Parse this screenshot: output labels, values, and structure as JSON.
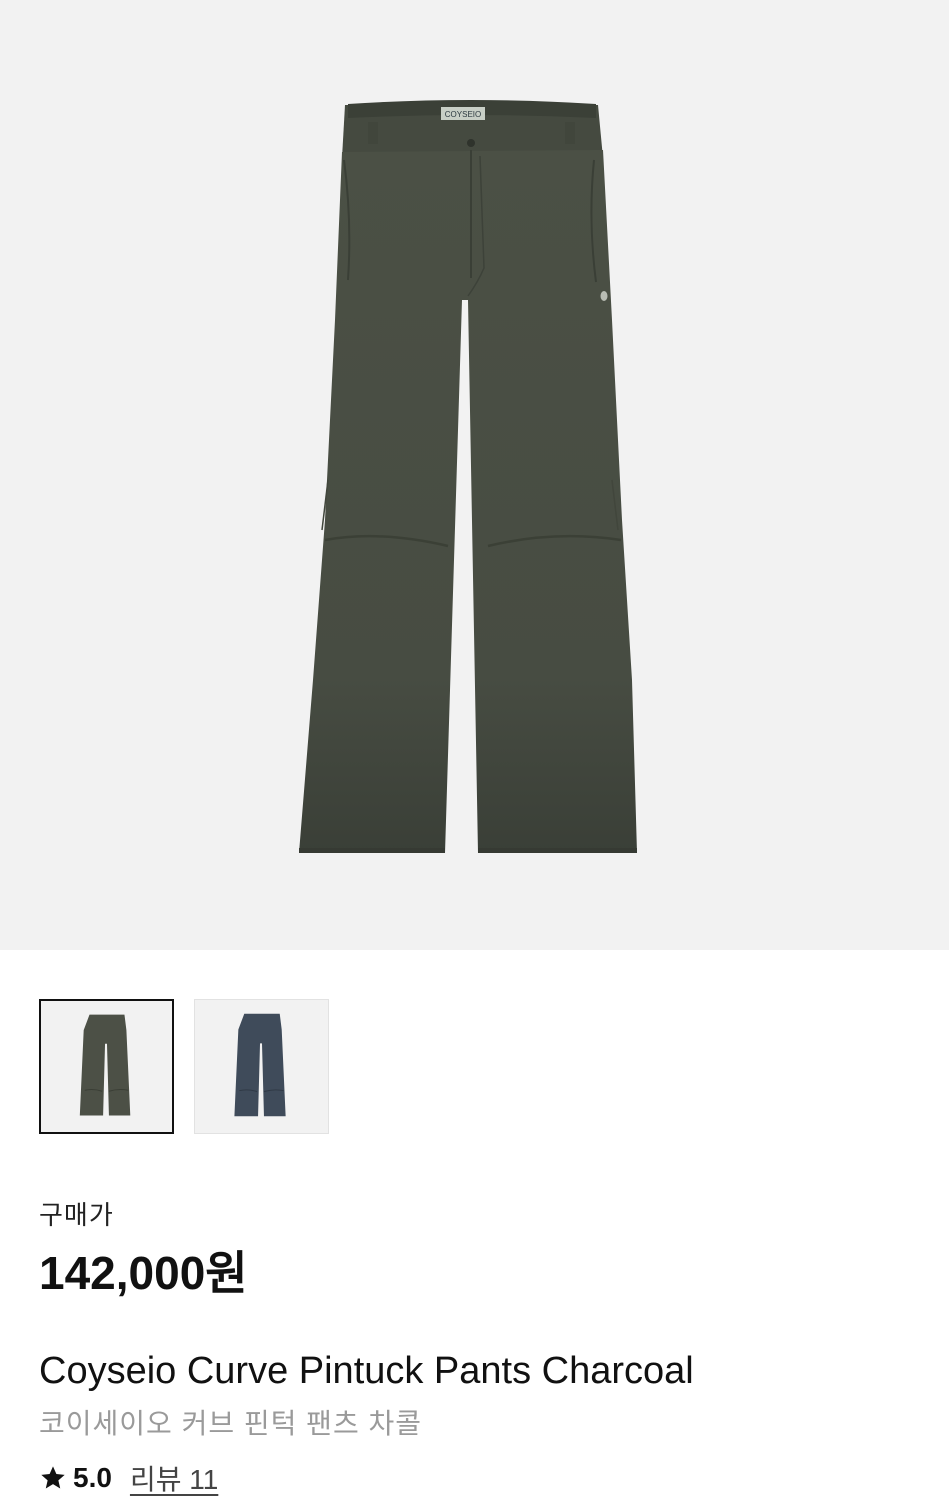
{
  "product": {
    "image": {
      "alt": "Coyseio Curve Pintuck Pants Charcoal",
      "label_text": "COYSEIO",
      "color": "#4a4f44"
    },
    "thumbnails": [
      {
        "name": "charcoal",
        "color": "#4c5046",
        "selected": true
      },
      {
        "name": "navy",
        "color": "#3f4b5a",
        "selected": false
      }
    ],
    "price_label": "구매가",
    "price": "142,000원",
    "name_en": "Coyseio Curve Pintuck Pants Charcoal",
    "name_ko": "코이세이오 커브 핀턱 팬츠 차콜",
    "rating": "5.0",
    "reviews": "리뷰 11"
  }
}
